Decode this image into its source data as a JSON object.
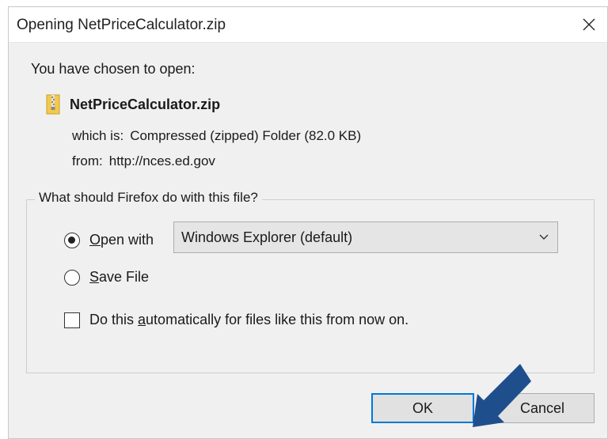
{
  "dialog": {
    "title": "Opening NetPriceCalculator.zip",
    "close_glyph": "✕",
    "heading": "You have chosen to open:",
    "file_name": "NetPriceCalculator.zip",
    "which_is_label": "which is:",
    "which_is_value": "Compressed (zipped) Folder (82.0 KB)",
    "from_label": "from:",
    "from_value": "http://nces.ed.gov",
    "group_label": "What should Firefox do with this file?",
    "open_with": {
      "accesskey": "O",
      "rest": "pen with",
      "selected": true
    },
    "open_with_select": {
      "value": "Windows Explorer (default)"
    },
    "save_file": {
      "accesskey": "S",
      "rest": "ave File",
      "selected": false
    },
    "auto_checkbox": {
      "pre": "Do this ",
      "accesskey": "a",
      "post": "utomatically for files like this from now on.",
      "checked": false
    },
    "ok_label": "OK",
    "cancel_label": "Cancel"
  },
  "colors": {
    "dialog_bg": "#f0f0f0",
    "focus_border": "#0078d7",
    "annotation_arrow": "#1f4e8c",
    "zip_icon": "#f2c94c"
  },
  "icons": {
    "file": "zip-folder-icon",
    "close": "close-icon",
    "dropdown": "chevron-down-icon",
    "annotation": "pointer-arrow-icon"
  }
}
